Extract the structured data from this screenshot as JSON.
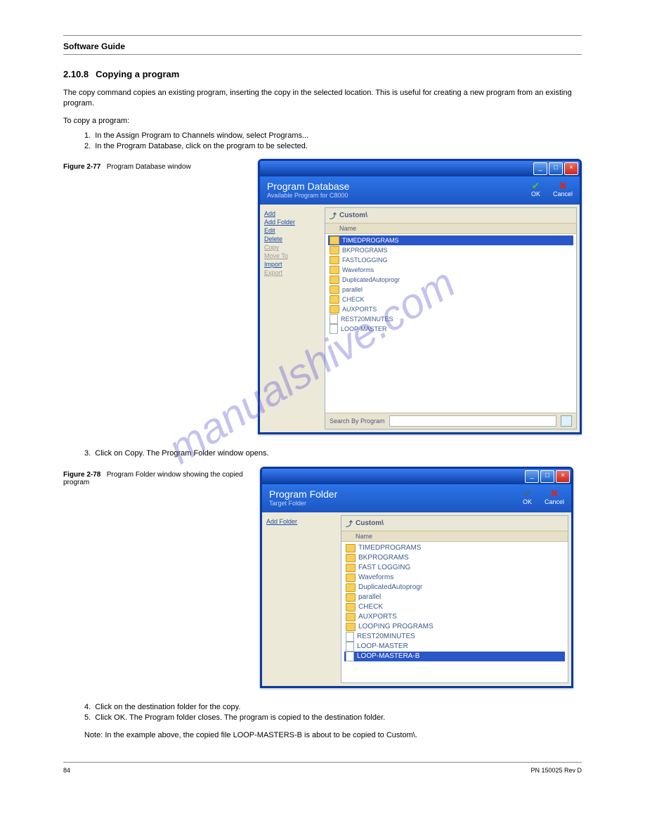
{
  "page": {
    "section_heading": "Software Guide",
    "section_num": "2.10.8",
    "section_title": "Copying a program",
    "intro": "The copy command copies an existing program, inserting the copy in the selected location. This is useful for creating a new program from an existing program.",
    "list_label": "To copy a program:",
    "list_items": [
      "In the Assign Program to Channels window, select Programs...",
      "In the Program Database, click on the program to be selected."
    ],
    "after_fig1": "Click on Copy. The Program Folder window opens.",
    "after_fig2_a": "Click on the destination folder for the copy.",
    "after_fig2_b": "Click OK. The Program folder closes. The program is copied to the destination folder.",
    "note": "Note: In the example above, the copied file LOOP-MASTERS-B is about to be copied to Custom\\."
  },
  "figures": {
    "f1": {
      "num": "Figure 2-77",
      "caption": "Program Database window"
    },
    "f2": {
      "num": "Figure 2-78",
      "caption": "Program Folder window showing the copied program"
    }
  },
  "window1": {
    "title": "Program Database",
    "subtitle": "Available Program for C8000",
    "ok": "OK",
    "cancel": "Cancel",
    "crumb": "Custom\\",
    "col": "Name",
    "sidebar": {
      "add": "Add",
      "addfolder": "Add Folder",
      "edit": "Edit",
      "delete": "Delete",
      "copy": "Copy",
      "moveto": "Move To",
      "import": "Import",
      "export": "Export"
    },
    "rows": [
      {
        "type": "folder",
        "name": "TIMEDPROGRAMS",
        "selected": true
      },
      {
        "type": "folder",
        "name": "BKPROGRAMS"
      },
      {
        "type": "folder",
        "name": "FASTLOGGING"
      },
      {
        "type": "folder",
        "name": "Waveforms"
      },
      {
        "type": "folder",
        "name": "DuplicatedAutoprogr"
      },
      {
        "type": "folder",
        "name": "parallel"
      },
      {
        "type": "folder",
        "name": "CHECK"
      },
      {
        "type": "folder",
        "name": "AUXPORTS"
      },
      {
        "type": "doc",
        "name": "REST20MINUTES"
      },
      {
        "type": "doc",
        "name": "LOOP-MASTER"
      }
    ],
    "search_label": "Search By Program"
  },
  "window2": {
    "title": "Program Folder",
    "subtitle": "Target Folder",
    "ok": "OK",
    "cancel": "Cancel",
    "crumb": "Custom\\",
    "col": "Name",
    "sidebar": {
      "addfolder": "Add Folder"
    },
    "rows": [
      {
        "type": "folder",
        "name": "TIMEDPROGRAMS"
      },
      {
        "type": "folder",
        "name": "BKPROGRAMS"
      },
      {
        "type": "folder",
        "name": "FAST LOGGING"
      },
      {
        "type": "folder",
        "name": "Waveforms"
      },
      {
        "type": "folder",
        "name": "DuplicatedAutoprogr"
      },
      {
        "type": "folder",
        "name": "parallel"
      },
      {
        "type": "folder",
        "name": "CHECK"
      },
      {
        "type": "folder",
        "name": "AUXPORTS"
      },
      {
        "type": "folder",
        "name": "LOOPING PROGRAMS"
      },
      {
        "type": "doc",
        "name": "REST20MINUTES"
      },
      {
        "type": "doc",
        "name": "LOOP-MASTER"
      },
      {
        "type": "doc",
        "name": "LOOP-MASTERA-B",
        "selected": true
      }
    ]
  },
  "footer": {
    "left": "84",
    "right": "PN 150025 Rev D"
  },
  "watermark": "manualshive.com"
}
